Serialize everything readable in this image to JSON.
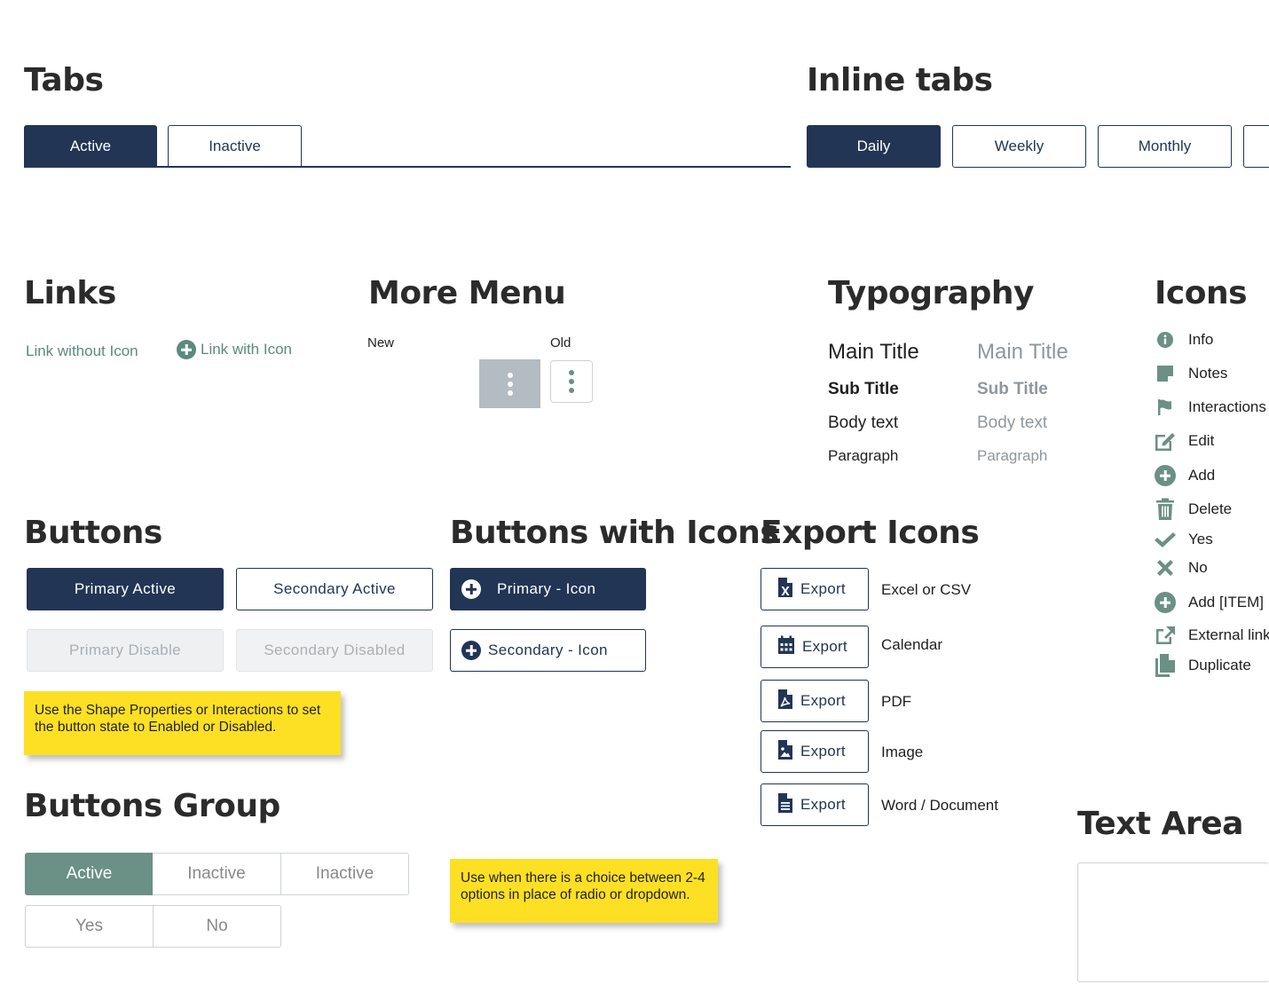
{
  "tabs": {
    "heading": "Tabs",
    "items": [
      {
        "label": "Active"
      },
      {
        "label": "Inactive"
      }
    ]
  },
  "inline_tabs": {
    "heading": "Inline tabs",
    "items": [
      {
        "label": "Daily"
      },
      {
        "label": "Weekly"
      },
      {
        "label": "Monthly"
      }
    ]
  },
  "links": {
    "heading": "Links",
    "without_icon": "Link without Icon",
    "with_icon": "Link with Icon"
  },
  "more_menu": {
    "heading": "More Menu",
    "new_label": "New",
    "old_label": "Old"
  },
  "typography": {
    "heading": "Typography",
    "main_title": "Main Title",
    "sub_title": "Sub Title",
    "body_text": "Body text",
    "paragraph": "Paragraph"
  },
  "icons": {
    "heading": "Icons",
    "items": [
      {
        "label": "Info",
        "icon": "info-icon"
      },
      {
        "label": "Notes",
        "icon": "notes-icon"
      },
      {
        "label": "Interactions",
        "icon": "flag-icon"
      },
      {
        "label": "Edit",
        "icon": "edit-icon"
      },
      {
        "label": "Add",
        "icon": "add-icon"
      },
      {
        "label": "Delete",
        "icon": "trash-icon"
      },
      {
        "label": "Yes",
        "icon": "check-icon"
      },
      {
        "label": "No",
        "icon": "close-icon"
      },
      {
        "label": "Add [ITEM]",
        "icon": "add-item-icon"
      },
      {
        "label": "External link",
        "icon": "external-link-icon"
      },
      {
        "label": "Duplicate",
        "icon": "duplicate-icon"
      }
    ]
  },
  "buttons": {
    "heading": "Buttons",
    "primary_active": "Primary Active",
    "secondary_active": "Secondary Active",
    "primary_disable": "Primary Disable",
    "secondary_disabled": "Secondary Disabled",
    "note": "Use the Shape Properties or Interactions to set the button state to Enabled or Disabled."
  },
  "buttons_with_icons": {
    "heading": "Buttons with Icons",
    "primary": "Primary - Icon",
    "secondary": "Secondary - Icon"
  },
  "export_icons": {
    "heading": "Export Icons",
    "items": [
      {
        "button": "Export",
        "label": "Excel or CSV",
        "icon": "excel-icon"
      },
      {
        "button": "Export",
        "label": "Calendar",
        "icon": "calendar-icon"
      },
      {
        "button": "Export",
        "label": "PDF",
        "icon": "pdf-icon"
      },
      {
        "button": "Export",
        "label": "Image",
        "icon": "image-icon"
      },
      {
        "button": "Export",
        "label": "Word / Document",
        "icon": "document-icon"
      }
    ]
  },
  "buttons_group": {
    "heading": "Buttons Group",
    "row1": [
      {
        "label": "Active"
      },
      {
        "label": "Inactive"
      },
      {
        "label": "Inactive"
      }
    ],
    "row2": [
      {
        "label": "Yes"
      },
      {
        "label": "No"
      }
    ],
    "note": "Use when there is a choice between 2-4 options in place of radio or dropdown."
  },
  "text_area": {
    "heading": "Text Area"
  },
  "colors": {
    "navy": "#223555",
    "teal": "#6b9085",
    "link": "#5b8a7e",
    "note_yellow": "#fde024"
  }
}
